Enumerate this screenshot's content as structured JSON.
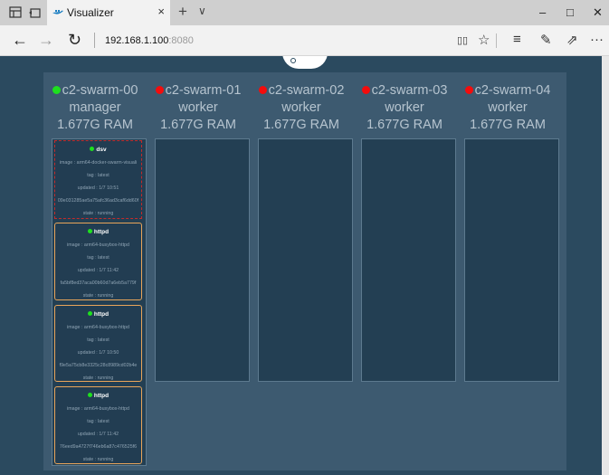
{
  "browser": {
    "tab_title": "Visualizer",
    "tab_close": "×",
    "new_tab": "+",
    "tab_list": "∨",
    "url_host": "192.168.1.100",
    "url_port": ":8080",
    "icons": [
      "back-arrow-icon",
      "forward-arrow-icon",
      "refresh-icon",
      "reading-view-icon",
      "favorite-star-icon",
      "hub-icon",
      "web-note-icon",
      "share-icon",
      "more-icon"
    ],
    "back": "←",
    "forward": "→",
    "refresh": "↻",
    "reading": "▯▯",
    "favorite": "☆",
    "hub": "≡",
    "note": "✎",
    "share": "⇗",
    "more": "···",
    "minimize": "–",
    "maximize": "□",
    "close": "✕"
  },
  "nodes": [
    {
      "name": "c2-swarm-00",
      "status": "up",
      "status_color": "#1ee01e",
      "role": "manager",
      "ram": "1.677G RAM"
    },
    {
      "name": "c2-swarm-01",
      "status": "down",
      "status_color": "#f40c0c",
      "role": "worker",
      "ram": "1.677G RAM"
    },
    {
      "name": "c2-swarm-02",
      "status": "down",
      "status_color": "#f40c0c",
      "role": "worker",
      "ram": "1.677G RAM"
    },
    {
      "name": "c2-swarm-03",
      "status": "down",
      "status_color": "#f40c0c",
      "role": "worker",
      "ram": "1.677G RAM"
    },
    {
      "name": "c2-swarm-04",
      "status": "down",
      "status_color": "#f40c0c",
      "role": "worker",
      "ram": "1.677G RAM"
    }
  ],
  "containers": [
    {
      "name": "dsv",
      "image": "image : arm64-docker-swarm-visuali",
      "tag": "tag : latest",
      "updated": "updated : 1/7 10:51",
      "id": "09e031285ae5a75afc36ad3caf6dd60f",
      "state": "state : running"
    },
    {
      "name": "httpd",
      "image": "image : arm64-busybox-httpd",
      "tag": "tag : latest",
      "updated": "updated : 1/7 11:42",
      "id": "fa5bf8ed37aca00b60d7a6eb5a779f",
      "state": "state : running"
    },
    {
      "name": "httpd",
      "image": "image : arm64-busybox-httpd",
      "tag": "tag : latest",
      "updated": "updated : 1/7 10:50",
      "id": "f9e5a75cb8e3325c28c8989cd02b4e",
      "state": "state : running"
    },
    {
      "name": "httpd",
      "image": "image : arm64-busybox-httpd",
      "tag": "tag : latest",
      "updated": "updated : 1/7 11:42",
      "id": "76eed9a4727f746eb6a87c476525f6",
      "state": "state : running"
    }
  ]
}
